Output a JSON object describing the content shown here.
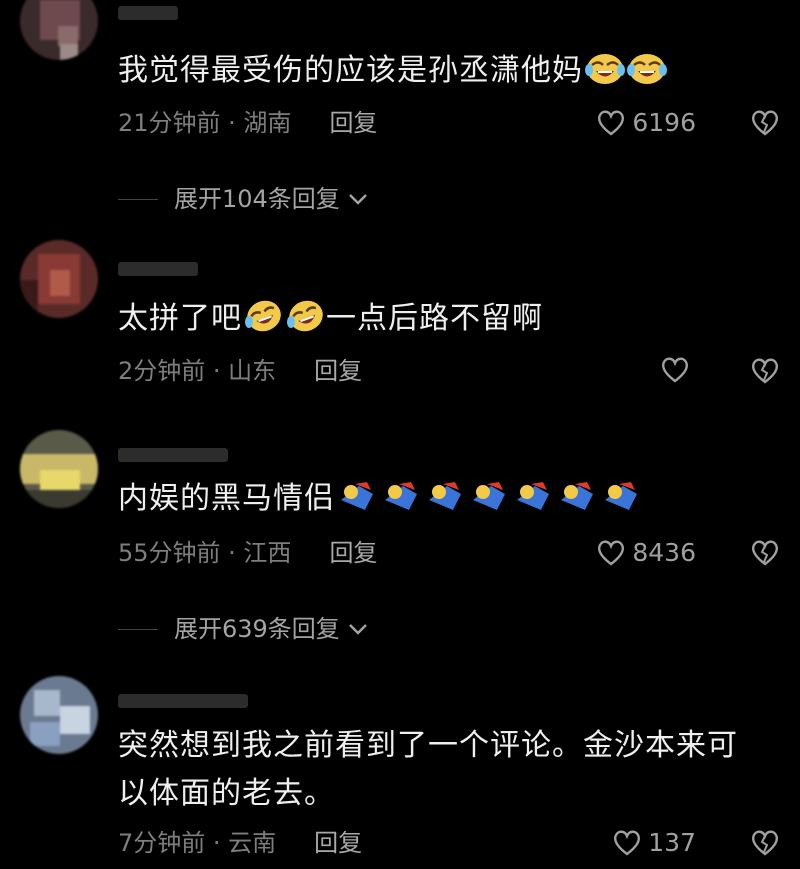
{
  "colors": {
    "background": "#000000",
    "text": "#efefef",
    "meta": "#7e7e7e",
    "reply": "#a9a9a9"
  },
  "comments": [
    {
      "text": "我觉得最受伤的应该是孙丞潇他妈",
      "emojis": [
        "laughing-crying-emoji",
        "laughing-crying-emoji"
      ],
      "time_location": "21分钟前 · 湖南",
      "reply_label": "回复",
      "likes": "6196",
      "expand_label": "展开104条回复"
    },
    {
      "text_before": "太拼了吧",
      "emojis": [
        "rofl-emoji",
        "rofl-emoji"
      ],
      "text_after": "一点后路不留啊",
      "time_location": "2分钟前 · 山东",
      "reply_label": "回复",
      "likes": ""
    },
    {
      "text": "内娱的黑马情侣",
      "emojis": [
        "superhero-emoji",
        "superhero-emoji",
        "superhero-emoji",
        "superhero-emoji",
        "superhero-emoji",
        "superhero-emoji",
        "superhero-emoji"
      ],
      "time_location": "55分钟前 · 江西",
      "reply_label": "回复",
      "likes": "8436",
      "expand_label": "展开639条回复"
    },
    {
      "text": "突然想到我之前看到了一个评论。金沙本来可以体面的老去。",
      "time_location": "7分钟前 · 云南",
      "reply_label": "回复",
      "likes": "137"
    }
  ]
}
